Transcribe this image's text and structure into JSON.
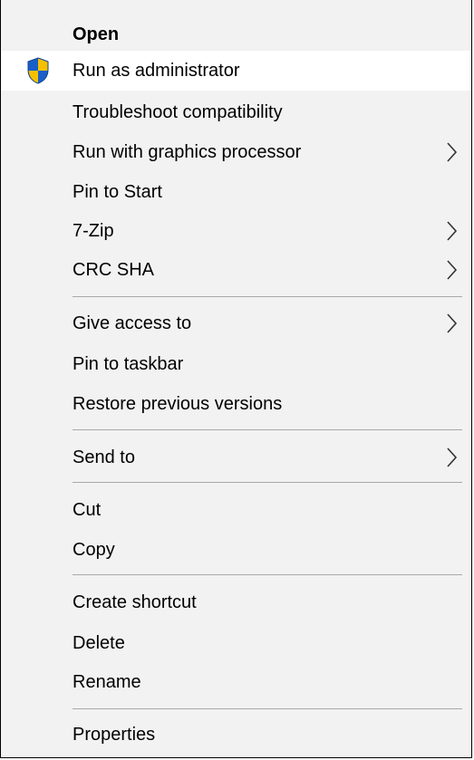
{
  "menu": {
    "items": [
      {
        "label": "Open"
      },
      {
        "label": "Run as administrator"
      },
      {
        "label": "Troubleshoot compatibility"
      },
      {
        "label": "Run with graphics processor"
      },
      {
        "label": "Pin to Start"
      },
      {
        "label": "7-Zip"
      },
      {
        "label": "CRC SHA"
      },
      {
        "label": "Give access to"
      },
      {
        "label": "Pin to taskbar"
      },
      {
        "label": "Restore previous versions"
      },
      {
        "label": "Send to"
      },
      {
        "label": "Cut"
      },
      {
        "label": "Copy"
      },
      {
        "label": "Create shortcut"
      },
      {
        "label": "Delete"
      },
      {
        "label": "Rename"
      },
      {
        "label": "Properties"
      }
    ],
    "icons": {
      "run_as_admin": "uac-shield-icon",
      "submenu": "chevron-right-icon"
    },
    "colors": {
      "background": "#f2f2f2",
      "hover": "#ffffff",
      "separator": "#a8a8a8",
      "shield_blue": "#1a5fc8",
      "shield_yellow": "#f5c000"
    }
  }
}
